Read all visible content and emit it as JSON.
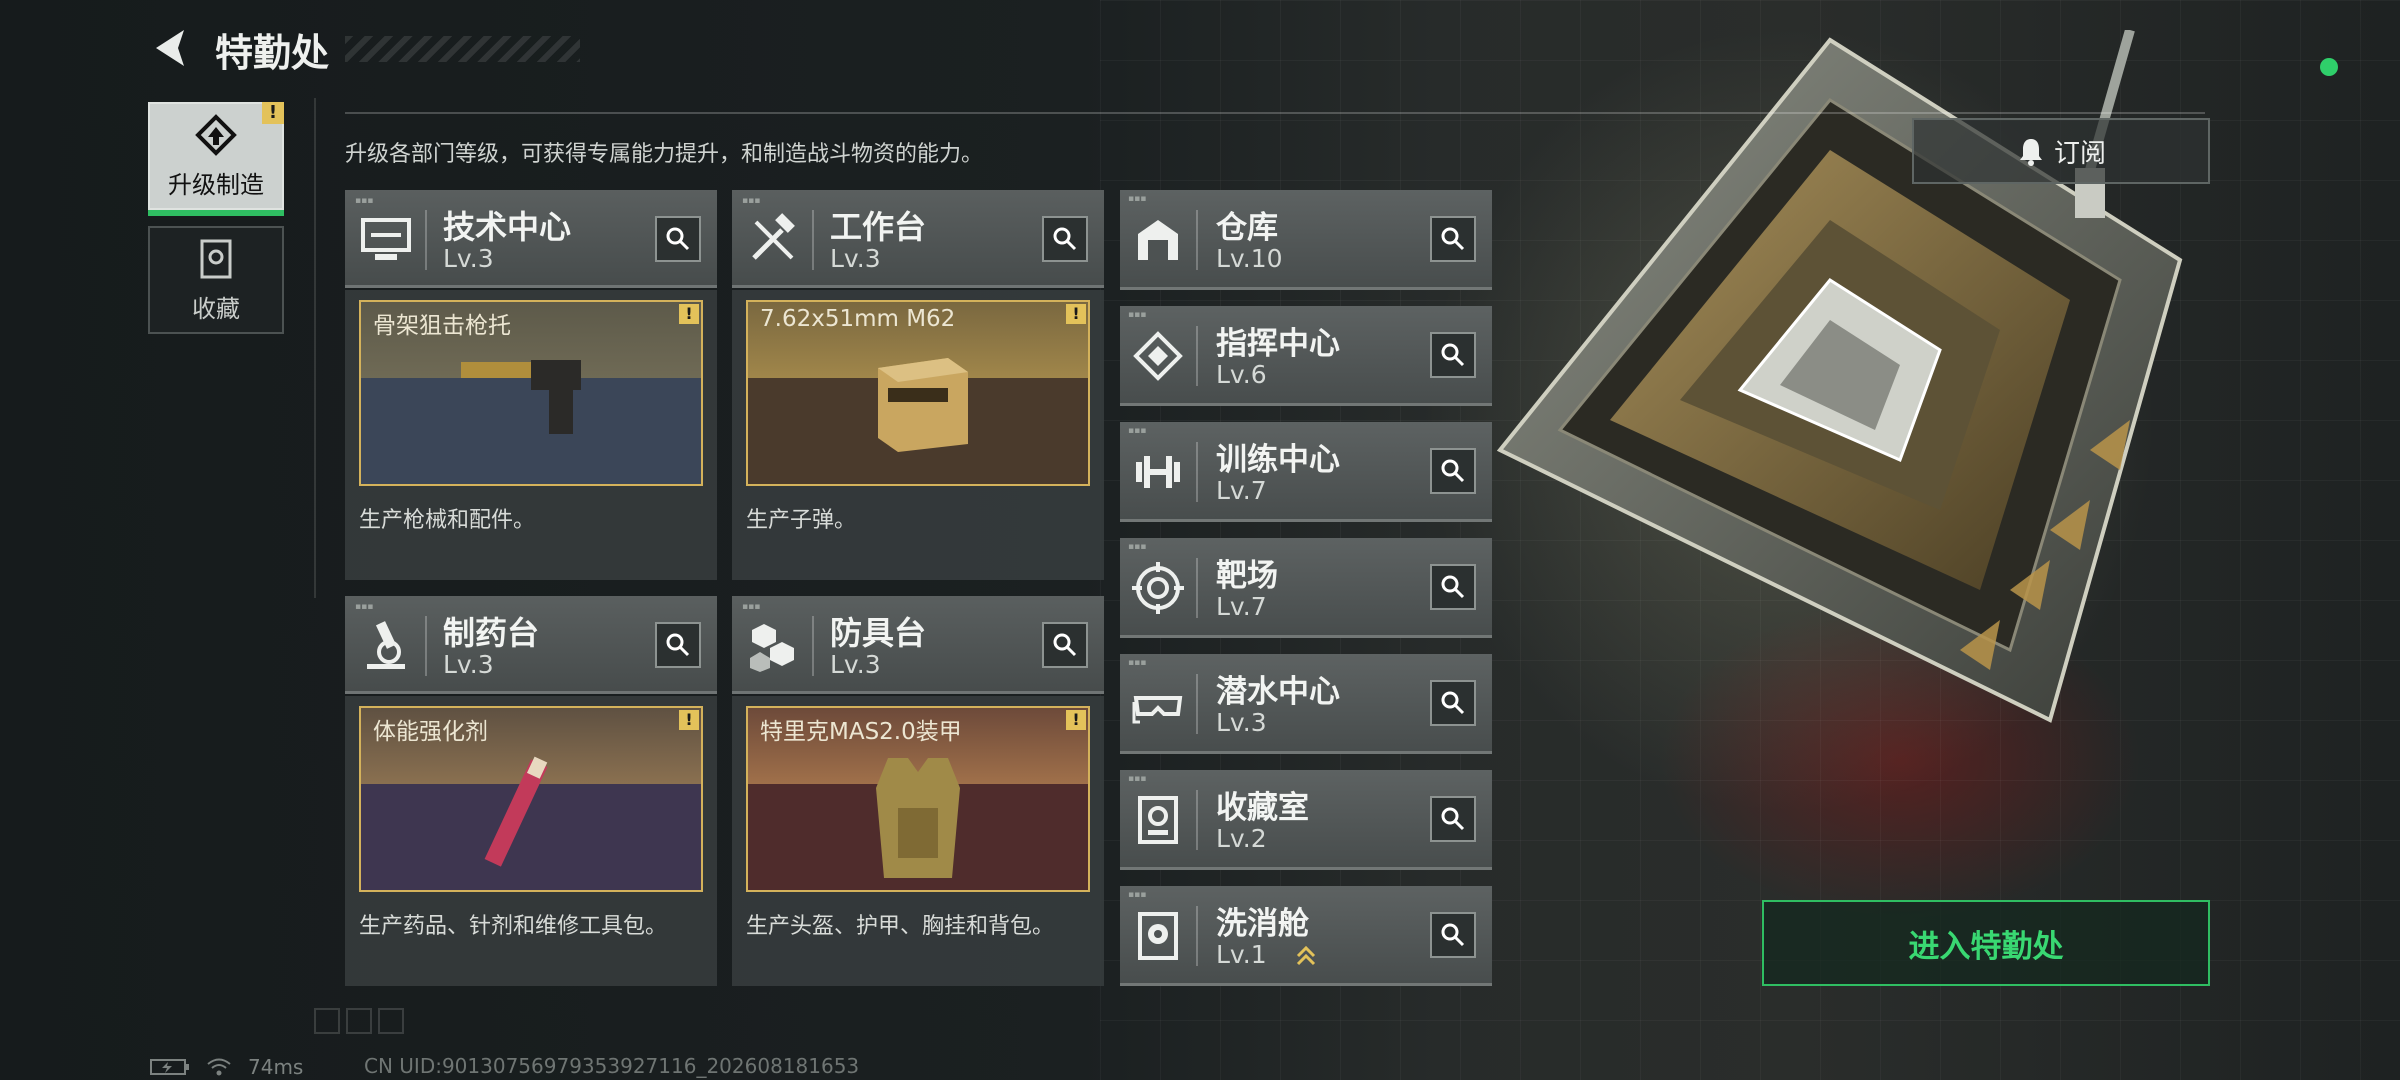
{
  "header": {
    "title": "特勤处"
  },
  "side_nav": [
    {
      "label": "升级制造",
      "active": true,
      "warning": "!"
    },
    {
      "label": "收藏",
      "active": false
    }
  ],
  "description": "升级各部门等级，可获得专属能力提升，和制造战斗物资的能力。",
  "subscribe_label": "订阅",
  "workshops": [
    {
      "name": "技术中心",
      "level": "Lv.3",
      "product": "骨架狙击枪托",
      "desc": "生产枪械和配件。",
      "warning": "!",
      "icon": "monitor-icon"
    },
    {
      "name": "工作台",
      "level": "Lv.3",
      "product": "7.62x51mm M62",
      "desc": "生产子弹。",
      "warning": "!",
      "icon": "tools-icon"
    },
    {
      "name": "制药台",
      "level": "Lv.3",
      "product": "体能强化剂",
      "desc": "生产药品、针剂和维修工具包。",
      "warning": "!",
      "icon": "microscope-icon"
    },
    {
      "name": "防具台",
      "level": "Lv.3",
      "product": "特里克MAS2.0装甲",
      "desc": "生产头盔、护甲、胸挂和背包。",
      "warning": "!",
      "icon": "armor-blocks-icon"
    }
  ],
  "departments": [
    {
      "name": "仓库",
      "level": "Lv.10",
      "icon": "warehouse-icon"
    },
    {
      "name": "指挥中心",
      "level": "Lv.6",
      "icon": "chip-icon"
    },
    {
      "name": "训练中心",
      "level": "Lv.7",
      "icon": "dumbbell-icon"
    },
    {
      "name": "靶场",
      "level": "Lv.7",
      "icon": "target-icon"
    },
    {
      "name": "潜水中心",
      "level": "Lv.3",
      "icon": "goggles-icon"
    },
    {
      "name": "收藏室",
      "level": "Lv.2",
      "icon": "collection-icon"
    },
    {
      "name": "洗消舱",
      "level": "Lv.1",
      "icon": "decon-icon",
      "upgradable": true
    }
  ],
  "enter_label": "进入特勤处",
  "status": {
    "ping": "74ms",
    "uid": "CN UID:9013075697935392​7116_202608181653"
  },
  "colors": {
    "accent_green": "#2fbe62",
    "warning_yellow": "#e3c25a",
    "product_border": "#d4b25b"
  }
}
